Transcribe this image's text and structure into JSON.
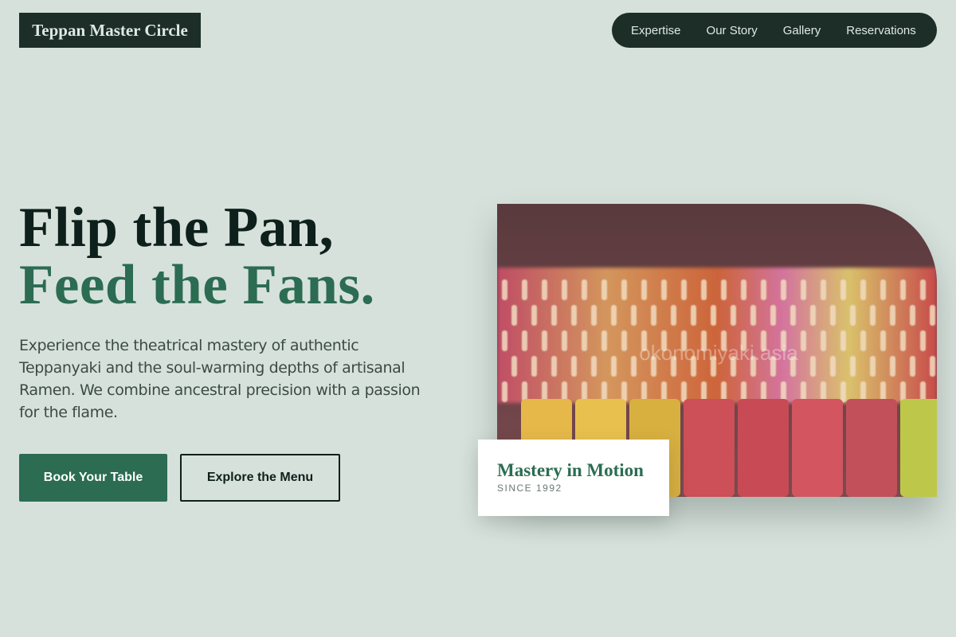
{
  "brand": {
    "name": "Teppan Master Circle"
  },
  "nav": {
    "items": [
      {
        "label": "Expertise"
      },
      {
        "label": "Our Story"
      },
      {
        "label": "Gallery"
      },
      {
        "label": "Reservations"
      }
    ]
  },
  "hero": {
    "headline_line1": "Flip the Pan,",
    "headline_line2": "Feed the Fans.",
    "lead": "Experience the theatrical mastery of authentic Teppanyaki and the soul-warming depths of artisanal Ramen. We combine ancestral precision with a passion for the flame.",
    "primary_cta": "Book Your Table",
    "secondary_cta": "Explore the Menu",
    "image_watermark": "okonomiyaki.asia",
    "caption_title": "Mastery in Motion",
    "caption_subtitle": "SINCE 1992"
  },
  "colors": {
    "background": "#d7e1dc",
    "dark": "#1d2e29",
    "accent": "#2b6c52"
  }
}
